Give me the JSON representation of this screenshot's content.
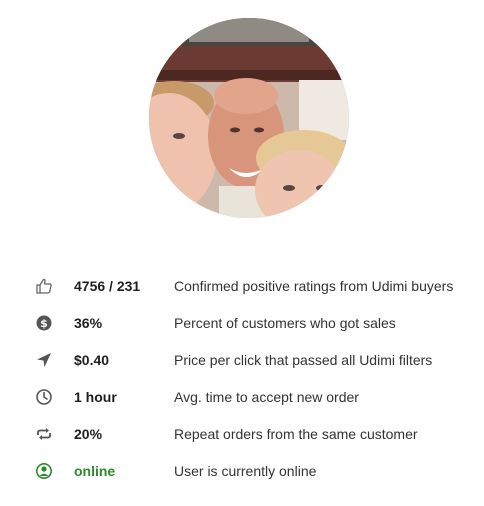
{
  "profile": {
    "avatar_alt": "profile photo"
  },
  "stats": [
    {
      "icon": "thumbs-up-icon",
      "value": "4756 / 231",
      "description": "Confirmed positive ratings from Udimi buyers"
    },
    {
      "icon": "dollar-circle-icon",
      "value": "36%",
      "description": "Percent of customers who got sales"
    },
    {
      "icon": "location-arrow-icon",
      "value": "$0.40",
      "description": "Price per click that passed all Udimi filters"
    },
    {
      "icon": "clock-icon",
      "value": "1 hour",
      "description": "Avg. time to accept new order"
    },
    {
      "icon": "repeat-icon",
      "value": "20%",
      "description": "Repeat orders from the same customer"
    },
    {
      "icon": "user-circle-icon",
      "value": "online",
      "description": "User is currently online"
    }
  ],
  "colors": {
    "icon_gray": "#555555",
    "online_green": "#2d8a2d",
    "text": "#333333"
  }
}
